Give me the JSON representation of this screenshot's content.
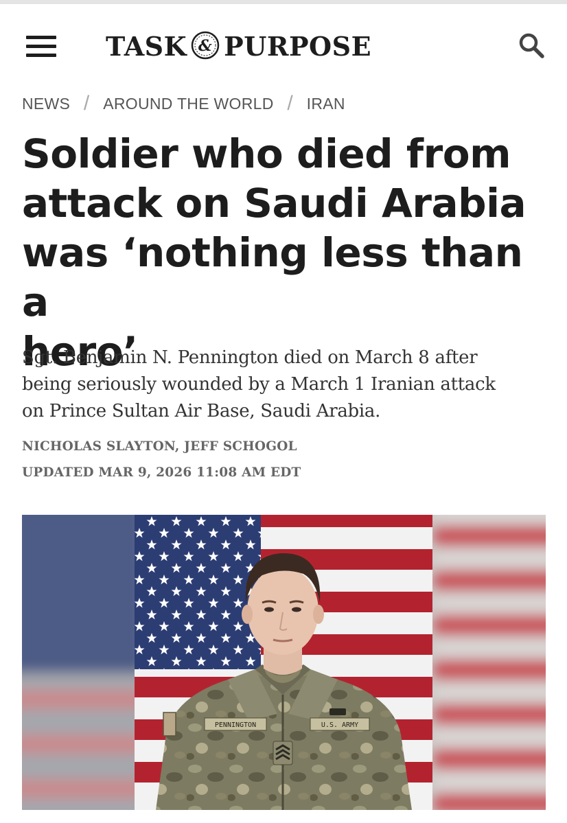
{
  "header": {
    "logo_left": "TASK",
    "logo_amp": "&",
    "logo_right": "PURPOSE"
  },
  "breadcrumb": {
    "items": [
      "NEWS",
      "AROUND THE WORLD",
      "IRAN"
    ],
    "separator": "/"
  },
  "article": {
    "headline_lines": [
      "Soldier who died from",
      "attack on Saudi Arabia",
      "was ‘nothing less than a",
      "hero’"
    ],
    "dek_lines": [
      "Sgt. Benjamin N. Pennington died on March 8 after",
      "being seriously wounded by a March 1 Iranian attack",
      "on Prince Sultan Air Base, Saudi Arabia."
    ],
    "authors": [
      "NICHOLAS SLAYTON",
      "JEFF SCHOGOL"
    ],
    "author_separator": ", ",
    "updated": "UPDATED MAR 9, 2026 11:08 AM EDT"
  },
  "image": {
    "name_tape": "PENNINGTON",
    "branch_tape": "U.S. ARMY"
  },
  "colors": {
    "text_dark": "#1d1d1d",
    "text_meta": "#666666",
    "flag_blue": "#2c3d73",
    "flag_red": "#b3232f",
    "uniform": "#7a7a5e"
  }
}
